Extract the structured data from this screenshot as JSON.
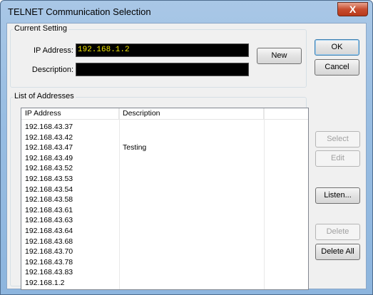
{
  "window": {
    "title": "TELNET Communication Selection",
    "close_glyph": "X"
  },
  "current_setting": {
    "group_label": "Current Setting",
    "ip_label": "IP Address:",
    "ip_value": "192.168.1.2",
    "description_label": "Description:",
    "description_value": ""
  },
  "buttons": {
    "new": "New",
    "ok": "OK",
    "cancel": "Cancel",
    "select": "Select",
    "edit": "Edit",
    "listen": "Listen...",
    "delete": "Delete",
    "delete_all": "Delete All"
  },
  "list": {
    "group_label": "List of Addresses",
    "columns": [
      "IP Address",
      "Description",
      ""
    ],
    "rows": [
      [
        "192.168.43.37",
        ""
      ],
      [
        "192.168.43.42",
        ""
      ],
      [
        "192.168.43.47",
        "Testing"
      ],
      [
        "192.168.43.49",
        ""
      ],
      [
        "192.168.43.52",
        ""
      ],
      [
        "192.168.43.53",
        ""
      ],
      [
        "192.168.43.54",
        ""
      ],
      [
        "192.168.43.58",
        ""
      ],
      [
        "192.168.43.61",
        ""
      ],
      [
        "192.168.43.63",
        ""
      ],
      [
        "192.168.43.64",
        ""
      ],
      [
        "192.168.43.68",
        ""
      ],
      [
        "192.168.43.70",
        ""
      ],
      [
        "192.168.43.78",
        ""
      ],
      [
        "192.168.43.83",
        ""
      ],
      [
        "192.168.1.2",
        ""
      ]
    ]
  },
  "colors": {
    "field_bg": "#000000",
    "field_text": "#f2e600",
    "title_bar": "#98bde2",
    "close_button": "#c74d2f"
  }
}
